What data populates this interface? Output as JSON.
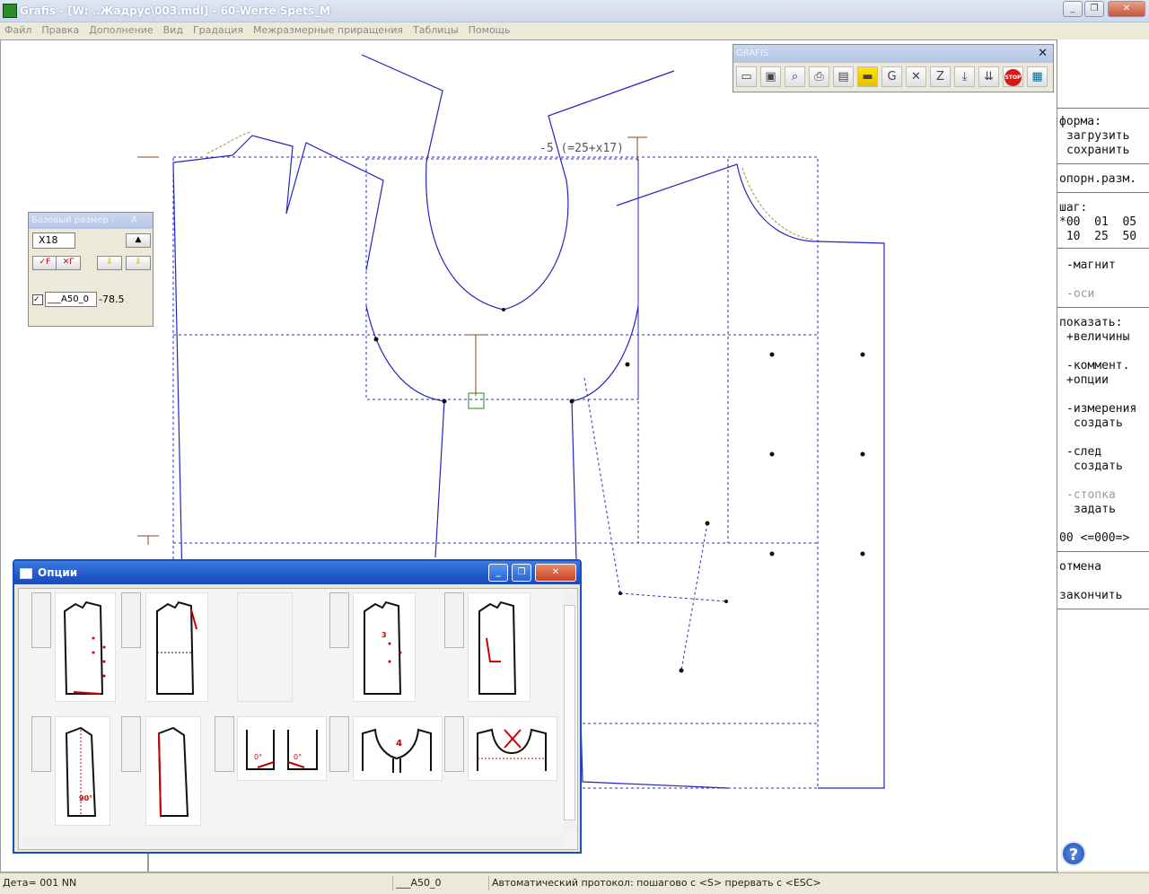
{
  "window": {
    "title": "Grafis - [W: ..Жадрус\\003.mdl] - 60-Werte Spets_M",
    "buttons": {
      "minimize": "_",
      "restore": "❐",
      "close": "✕"
    }
  },
  "menu": [
    "Файл",
    "Правка",
    "Дополнение",
    "Вид",
    "Градация",
    "Межразмерные приращения",
    "Таблицы",
    "Помощь"
  ],
  "canvas": {
    "formula_label": "-5 (=25+x17)"
  },
  "grafis_toolbar": {
    "title": "GRAFIS",
    "close": "✕",
    "icons": [
      "open-icon",
      "save-icon",
      "zoom-icon",
      "print-icon",
      "layers-icon",
      "ruler-icon",
      "g-icon",
      "delete-icon",
      "z-icon",
      "download-icon",
      "download-all-icon",
      "stop-icon",
      "calculator-icon"
    ],
    "stop_text": "STOP"
  },
  "base_size_panel": {
    "title": "Базовый размер :",
    "title_suffix": "A",
    "size_value": "X18",
    "btn_set": "✓F",
    "btn_clear": "✕Γ",
    "btn_down": "⇩",
    "btn_down2": "⇩",
    "param_name": "___A50_0",
    "param_value": "-78.5"
  },
  "right_panel": {
    "form_label": "форма:",
    "load": "загрузить",
    "save": "сохранить",
    "ref_size": "опорн.разм.",
    "step_label": "шаг:",
    "step_row1": "*00  01  05",
    "step_row2": " 10  25  50",
    "magnet": "-магнит",
    "axes": "-оси",
    "show_label": "показать:",
    "values": "+величины",
    "comments": "-коммент.",
    "options": "+опции",
    "measures": "-измерения",
    "measures_create": "создать",
    "trace": "-след",
    "trace_create": "создать",
    "column": "-стопка",
    "column_set": "задать",
    "counter": "00 <=000=>",
    "cancel": "отмена",
    "finish": "закончить",
    "help": "?"
  },
  "options_window": {
    "title": "Опции",
    "labels": [
      "3",
      "4",
      "90°",
      "0°",
      "0°"
    ]
  },
  "status_bar": {
    "cell1": "Дета= 001  NN",
    "cell2": "___A50_0",
    "cell3": "Автоматический протокол: пошагово с <S> прервать с <ESC>"
  }
}
